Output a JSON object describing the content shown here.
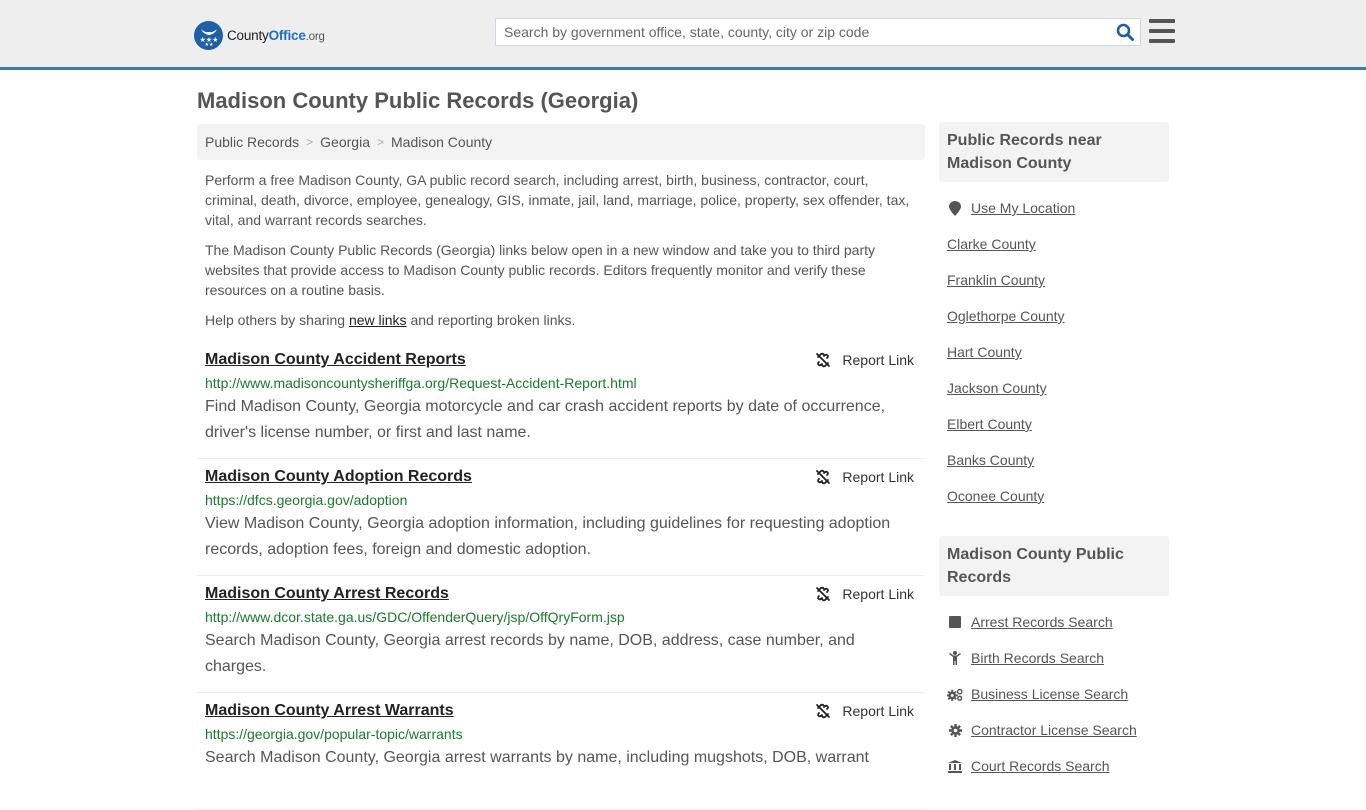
{
  "header": {
    "logo": {
      "county": "County",
      "office": "Office",
      "org": ".org"
    },
    "search": {
      "placeholder": "Search by government office, state, county, city or zip code",
      "value": ""
    },
    "colors": {
      "brand_blue": "#1f5fa6",
      "header_bg": "#eeeeee",
      "header_border": "#3b7bab"
    }
  },
  "page": {
    "title": "Madison County Public Records (Georgia)",
    "breadcrumb": [
      "Public Records",
      "Georgia",
      "Madison County"
    ],
    "intro": {
      "p1": "Perform a free Madison County, GA public record search, including arrest, birth, business, contractor, court, criminal, death, divorce, employee, genealogy, GIS, inmate, jail, land, marriage, police, property, sex offender, tax, vital, and warrant records searches.",
      "p2": "The Madison County Public Records (Georgia) links below open in a new window and take you to third party websites that provide access to Madison County public records. Editors frequently monitor and verify these resources on a routine basis.",
      "p3_before": "Help others by sharing ",
      "p3_link": "new links",
      "p3_after": " and reporting broken links."
    }
  },
  "records": [
    {
      "title": "Madison County Accident Reports",
      "url": "http://www.madisoncountysheriffga.org/Request-Accident-Report.html",
      "description": "Find Madison County, Georgia motorcycle and car crash accident reports by date of occurrence, driver's license number, or first and last name.",
      "report_label": "Report Link"
    },
    {
      "title": "Madison County Adoption Records",
      "url": "https://dfcs.georgia.gov/adoption",
      "description": "View Madison County, Georgia adoption information, including guidelines for requesting adoption records, adoption fees, foreign and domestic adoption.",
      "report_label": "Report Link"
    },
    {
      "title": "Madison County Arrest Records",
      "url": "http://www.dcor.state.ga.us/GDC/OffenderQuery/jsp/OffQryForm.jsp",
      "description": "Search Madison County, Georgia arrest records by name, DOB, address, case number, and charges.",
      "report_label": "Report Link"
    },
    {
      "title": "Madison County Arrest Warrants",
      "url": "https://georgia.gov/popular-topic/warrants",
      "description": "Search Madison County, Georgia arrest warrants by name, including mugshots, DOB, warrant",
      "report_label": "Report Link"
    }
  ],
  "sidebar": {
    "nearby": {
      "heading": "Public Records near Madison County",
      "use_location": {
        "label": "Use My Location",
        "icon": "map-marker-icon"
      },
      "counties": [
        "Clarke County",
        "Franklin County",
        "Oglethorpe County",
        "Hart County",
        "Jackson County",
        "Elbert County",
        "Banks County",
        "Oconee County"
      ]
    },
    "county_records": {
      "heading": "Madison County Public Records",
      "items": [
        {
          "label": "Arrest Records Search",
          "icon": "square-icon"
        },
        {
          "label": "Birth Records Search",
          "icon": "child-icon"
        },
        {
          "label": "Business License Search",
          "icon": "gears-icon"
        },
        {
          "label": "Contractor License Search",
          "icon": "gear-icon"
        },
        {
          "label": "Court Records Search",
          "icon": "courthouse-icon"
        }
      ]
    }
  }
}
